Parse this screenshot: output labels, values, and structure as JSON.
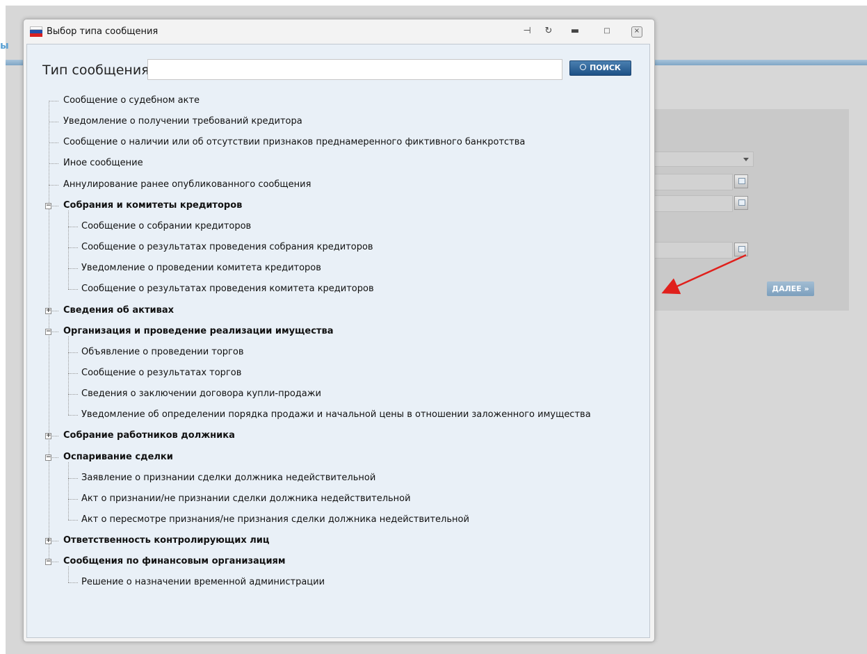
{
  "background": {
    "header_fragment": "ы",
    "next_button": "ДАЛЕЕ »"
  },
  "dialog": {
    "title": "Выбор типа сообщения",
    "controls": [
      "pin-icon",
      "refresh-icon",
      "minimize-icon",
      "maximize-icon",
      "close-icon"
    ]
  },
  "search": {
    "label": "Тип сообщения",
    "value": "",
    "button": "ПОИСК"
  },
  "tree": [
    {
      "label": "Сообщение о судебном акте",
      "level": 1,
      "group": false
    },
    {
      "label": "Уведомление о получении требований кредитора",
      "level": 1,
      "group": false
    },
    {
      "label": "Сообщение о наличии или об отсутствии признаков преднамеренного фиктивного банкротства",
      "level": 1,
      "group": false
    },
    {
      "label": "Иное сообщение",
      "level": 1,
      "group": false
    },
    {
      "label": "Аннулирование ранее опубликованного сообщения",
      "level": 1,
      "group": false
    },
    {
      "label": "Собрания и комитеты кредиторов",
      "level": 1,
      "group": true,
      "expanded": true
    },
    {
      "label": "Сообщение о собрании кредиторов",
      "level": 2,
      "group": false
    },
    {
      "label": "Сообщение о результатах проведения собрания кредиторов",
      "level": 2,
      "group": false
    },
    {
      "label": "Уведомление о проведении комитета кредиторов",
      "level": 2,
      "group": false
    },
    {
      "label": "Сообщение о результатах проведения комитета кредиторов",
      "level": 2,
      "group": false
    },
    {
      "label": "Сведения об активах",
      "level": 1,
      "group": true,
      "expanded": false
    },
    {
      "label": "Организация и проведение реализации имущества",
      "level": 1,
      "group": true,
      "expanded": true
    },
    {
      "label": "Объявление о проведении торгов",
      "level": 2,
      "group": false
    },
    {
      "label": "Сообщение о результатах торгов",
      "level": 2,
      "group": false
    },
    {
      "label": "Сведения о заключении договора купли-продажи",
      "level": 2,
      "group": false
    },
    {
      "label": "Уведомление об определении порядка продажи и начальной цены в отношении заложенного имущества",
      "level": 2,
      "group": false
    },
    {
      "label": "Собрание работников должника",
      "level": 1,
      "group": true,
      "expanded": false
    },
    {
      "label": "Оспаривание сделки",
      "level": 1,
      "group": true,
      "expanded": true
    },
    {
      "label": "Заявление о признании сделки должника недействительной",
      "level": 2,
      "group": false
    },
    {
      "label": "Акт о признании/не признании сделки должника недействительной",
      "level": 2,
      "group": false
    },
    {
      "label": "Акт о пересмотре признания/не признания сделки должника недействительной",
      "level": 2,
      "group": false
    },
    {
      "label": "Ответственность контролирующих лиц",
      "level": 1,
      "group": true,
      "expanded": false
    },
    {
      "label": "Сообщения по финансовым организациям",
      "level": 1,
      "group": true,
      "expanded": true
    },
    {
      "label": "Решение о назначении временной администрации",
      "level": 2,
      "group": false
    }
  ]
}
